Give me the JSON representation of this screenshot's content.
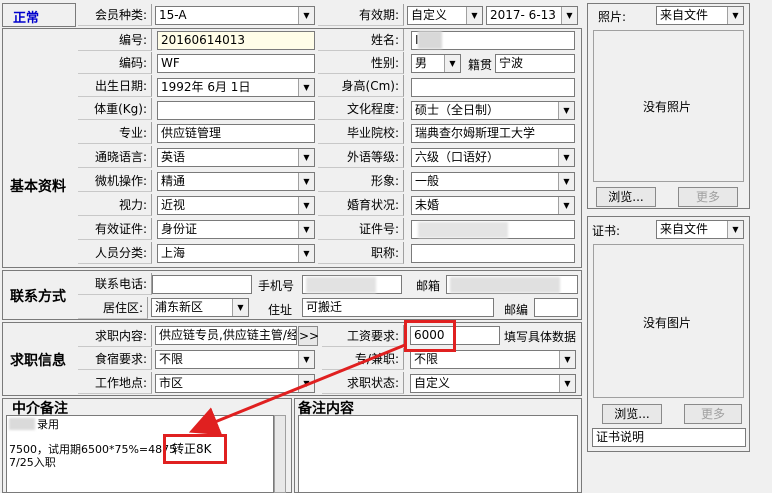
{
  "status": "正常",
  "member_type": {
    "label": "会员种类:",
    "value": "15-A"
  },
  "validity": {
    "label": "有效期:",
    "mode": "自定义",
    "date": "2017- 6-13"
  },
  "photo": {
    "label": "照片:",
    "source": "来自文件",
    "empty_text": "没有照片",
    "browse": "浏览...",
    "more": "更多"
  },
  "cert": {
    "label": "证书:",
    "source": "来自文件",
    "empty_text": "没有图片",
    "browse": "浏览...",
    "more": "更多",
    "note": "证书说明"
  },
  "basic": {
    "section_title": "基本资料",
    "number": {
      "label": "编号:",
      "value": "20160614013"
    },
    "name": {
      "label": "姓名:",
      "value": "I"
    },
    "code": {
      "label": "编码:",
      "value": "WF"
    },
    "gender": {
      "label": "性别:",
      "value": "男"
    },
    "native": {
      "label": "籍贯",
      "value": "宁波"
    },
    "birth": {
      "label": "出生日期:",
      "value": "1992年 6月 1日"
    },
    "height": {
      "label": "身高(Cm):",
      "value": ""
    },
    "weight": {
      "label": "体重(Kg):",
      "value": ""
    },
    "education": {
      "label": "文化程度:",
      "value": "硕士（全日制）"
    },
    "major": {
      "label": "专业:",
      "value": "供应链管理"
    },
    "school": {
      "label": "毕业院校:",
      "value": "瑞典查尔姆斯理工大学"
    },
    "language": {
      "label": "通晓语言:",
      "value": "英语"
    },
    "lang_level": {
      "label": "外语等级:",
      "value": "六级（口语好）"
    },
    "computer": {
      "label": "微机操作:",
      "value": "精通"
    },
    "image": {
      "label": "形象:",
      "value": "一般"
    },
    "vision": {
      "label": "视力:",
      "value": "近视"
    },
    "marital": {
      "label": "婚育状况:",
      "value": "未婚"
    },
    "id_type": {
      "label": "有效证件:",
      "value": "身份证"
    },
    "id_no": {
      "label": "证件号:",
      "value": ""
    },
    "category": {
      "label": "人员分类:",
      "value": "上海"
    },
    "title": {
      "label": "职称:",
      "value": ""
    }
  },
  "contact": {
    "section_title": "联系方式",
    "phone": {
      "label": "联系电话:",
      "value": ""
    },
    "mobile": {
      "label": "手机号",
      "value": ""
    },
    "email": {
      "label": "邮箱",
      "value": ""
    },
    "district": {
      "label": "居住区:",
      "value": "浦东新区"
    },
    "address": {
      "label": "住址",
      "value": "可搬迁"
    },
    "postcode": {
      "label": "邮编",
      "value": ""
    }
  },
  "job": {
    "section_title": "求职信息",
    "content": {
      "label": "求职内容:",
      "value": "供应链专员,供应链主管/经",
      "more": ">>"
    },
    "salary": {
      "label": "工资要求:",
      "value": "6000",
      "hint": "填写具体数据"
    },
    "meals": {
      "label": "食宿要求:",
      "value": "不限"
    },
    "parttime": {
      "label": "专/兼职:",
      "value": "不限"
    },
    "location": {
      "label": "工作地点:",
      "value": "市区"
    },
    "state": {
      "label": "求职状态:",
      "value": "自定义"
    }
  },
  "agency_note": {
    "title": "中介备注",
    "line1": "录用",
    "line2": "7500，试用期6500*75%=4875",
    "line3": "7/25入职",
    "annotation": "转正8K"
  },
  "remarks": {
    "title": "备注内容",
    "value": ""
  },
  "colors": {
    "status_blue": "#0000cc",
    "annotation_red": "#e02020"
  }
}
